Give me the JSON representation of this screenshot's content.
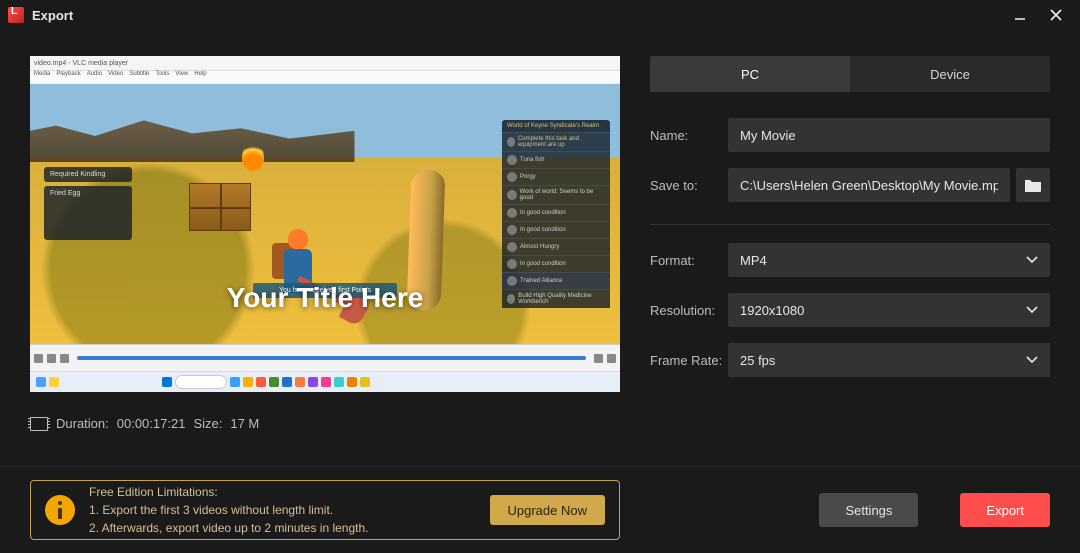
{
  "window": {
    "title": "Export"
  },
  "tabs": {
    "pc": "PC",
    "device": "Device"
  },
  "form": {
    "name_label": "Name:",
    "name_value": "My Movie",
    "save_label": "Save to:",
    "save_value": "C:\\Users\\Helen Green\\Desktop\\My Movie.mp4",
    "format_label": "Format:",
    "format_value": "MP4",
    "resolution_label": "Resolution:",
    "resolution_value": "1920x1080",
    "framerate_label": "Frame Rate:",
    "framerate_value": "25 fps"
  },
  "preview": {
    "overlay_title": "Your Title Here",
    "player_name": "video.mp4 - VLC media player",
    "menus": [
      "Media",
      "Playback",
      "Audio",
      "Video",
      "Subtitle",
      "Tools",
      "View",
      "Help"
    ],
    "toast": "You have received first Points",
    "left_panel": {
      "head": "Required Kindling",
      "item": "Fried Egg"
    },
    "right_panel": {
      "head": "World of Keyne Syndicate's Realm",
      "sub": "Complete this task and equipment are up",
      "items": [
        "Tuna fish",
        "Porgy",
        "Work of world: Seems to be good",
        "In good condition",
        "In good condition",
        "Almost Hungry",
        "In good condition",
        "Trained Alliance",
        "Build High Quality Medicine Workbench"
      ]
    }
  },
  "info": {
    "duration_label": "Duration:",
    "duration_value": "00:00:17:21",
    "size_label": "Size:",
    "size_value": "17 M"
  },
  "limitations": {
    "head": "Free Edition Limitations:",
    "line1": "1. Export the first 3 videos without length limit.",
    "line2": "2. Afterwards, export video up to 2 minutes in length.",
    "upgrade": "Upgrade Now"
  },
  "buttons": {
    "settings": "Settings",
    "export": "Export"
  }
}
